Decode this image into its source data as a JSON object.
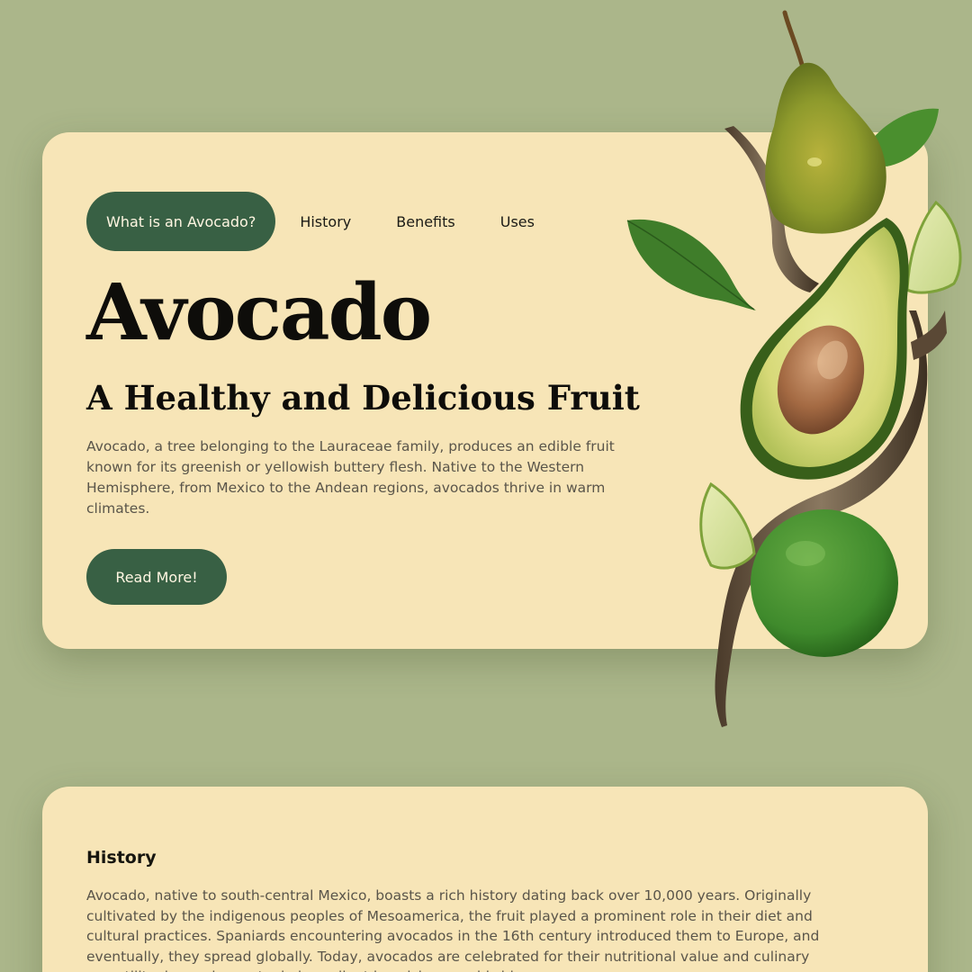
{
  "nav": {
    "items": [
      {
        "label": "What is an Avocado?",
        "active": true
      },
      {
        "label": "History",
        "active": false
      },
      {
        "label": "Benefits",
        "active": false
      },
      {
        "label": "Uses",
        "active": false
      }
    ]
  },
  "hero": {
    "title": "Avocado",
    "subtitle": "A Healthy and Delicious Fruit",
    "description": "Avocado, a tree belonging to the Lauraceae family, produces an edible fruit known for its greenish or yellowish buttery flesh. Native to the Western Hemisphere, from Mexico to the Andean regions, avocados thrive in warm climates.",
    "button_label": "Read More!"
  },
  "history": {
    "heading": "History",
    "text": "Avocado, native to south-central Mexico, boasts a rich history dating back over 10,000 years. Originally cultivated by the indigenous peoples of Mesoamerica, the fruit played a prominent role in their diet and cultural practices. Spaniards encountering avocados in the 16th century introduced them to Europe, and eventually, they spread globally. Today, avocados are celebrated for their nutritional value and culinary versatility, becoming a staple ingredient in cuisines worldwide."
  },
  "colors": {
    "page_background": "#abb68a",
    "card_background": "#f7e5b7",
    "accent": "#386044",
    "accent_text": "#fff6e2"
  },
  "icons": [
    "pear-image",
    "avocado-half-image",
    "lime-image",
    "leaf-image",
    "branch-image"
  ]
}
